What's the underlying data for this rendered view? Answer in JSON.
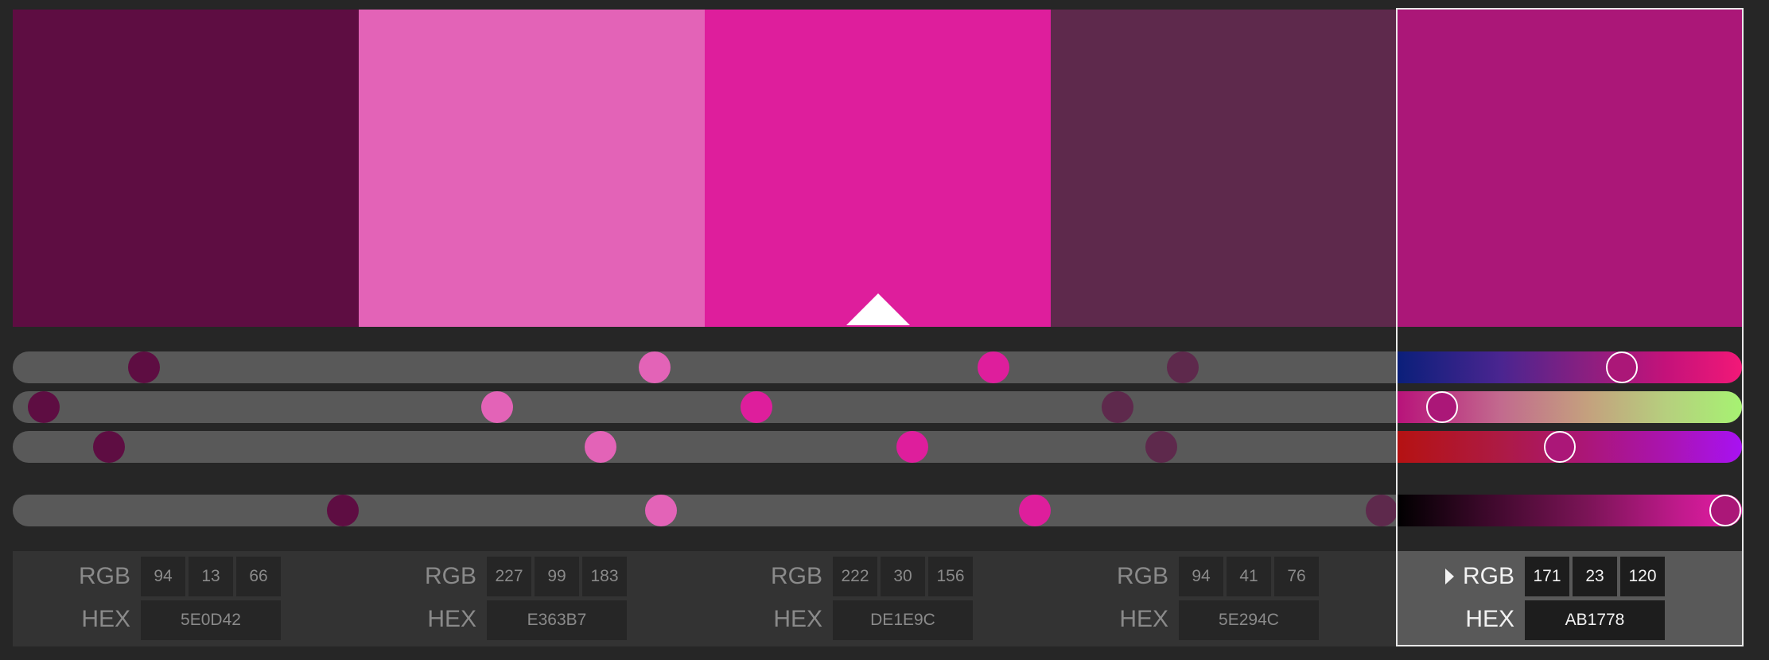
{
  "palette": [
    {
      "name": "color-1",
      "hex": "5E0D42",
      "rgb": [
        "94",
        "13",
        "66"
      ],
      "color": "#5E0D42"
    },
    {
      "name": "color-2",
      "hex": "E363B7",
      "rgb": [
        "227",
        "99",
        "183"
      ],
      "color": "#E363B7"
    },
    {
      "name": "color-3",
      "hex": "DE1E9C",
      "rgb": [
        "222",
        "30",
        "156"
      ],
      "color": "#DE1E9C"
    },
    {
      "name": "color-4",
      "hex": "5E294C",
      "rgb": [
        "94",
        "41",
        "76"
      ],
      "color": "#5E294C"
    },
    {
      "name": "color-5",
      "hex": "AB1778",
      "rgb": [
        "171",
        "23",
        "120"
      ],
      "color": "#AB1778"
    }
  ],
  "selected_index": 4,
  "base_index": 2,
  "labels": {
    "rgb": "RGB",
    "hex": "HEX"
  },
  "ui_colors": {
    "background": "#262626",
    "track": "#595959",
    "panel": "#333333",
    "panel_active": "#595959"
  }
}
